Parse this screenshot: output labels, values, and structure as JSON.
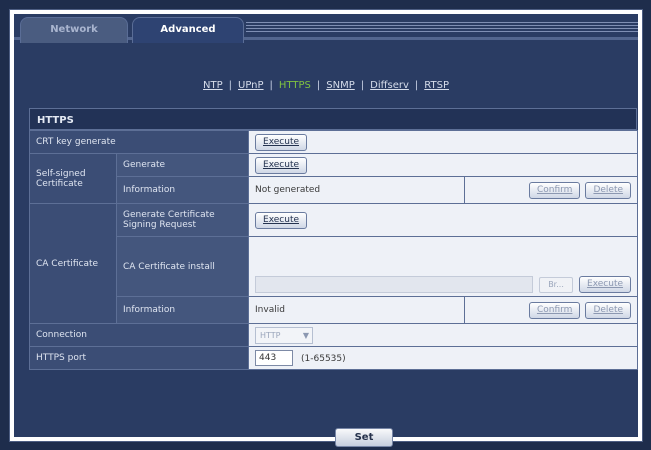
{
  "tabs": [
    {
      "label": "Network"
    },
    {
      "label": "Advanced"
    }
  ],
  "subnav": [
    {
      "label": "NTP"
    },
    {
      "label": "UPnP"
    },
    {
      "label": "HTTPS"
    },
    {
      "label": "SNMP"
    },
    {
      "label": "Diffserv"
    },
    {
      "label": "RTSP"
    }
  ],
  "subnav_separator": "|",
  "section_title": "HTTPS",
  "rows": {
    "crt_key_generate": {
      "label": "CRT key generate",
      "button": "Execute"
    },
    "self_signed": {
      "label": "Self-signed Certificate",
      "generate": {
        "label": "Generate",
        "button": "Execute"
      },
      "information": {
        "label": "Information",
        "value": "Not generated",
        "confirm": "Confirm",
        "delete": "Delete"
      }
    },
    "ca_certificate": {
      "label": "CA Certificate",
      "csr": {
        "label": "Generate Certificate Signing Request",
        "button": "Execute"
      },
      "install": {
        "label": "CA Certificate install",
        "browse": "Br...",
        "button": "Execute"
      },
      "information": {
        "label": "Information",
        "value": "Invalid",
        "confirm": "Confirm",
        "delete": "Delete"
      }
    },
    "connection": {
      "label": "Connection",
      "selected": "HTTP",
      "arrow": "▼"
    },
    "https_port": {
      "label": "HTTPS port",
      "value": "443",
      "range": "(1-65535)"
    }
  },
  "set_button": "Set",
  "colors": {
    "background": "#1e2d4c",
    "active_subnav": "#7fc241",
    "label_cell": "#3b4d75",
    "value_cell": "#eef1f7"
  }
}
